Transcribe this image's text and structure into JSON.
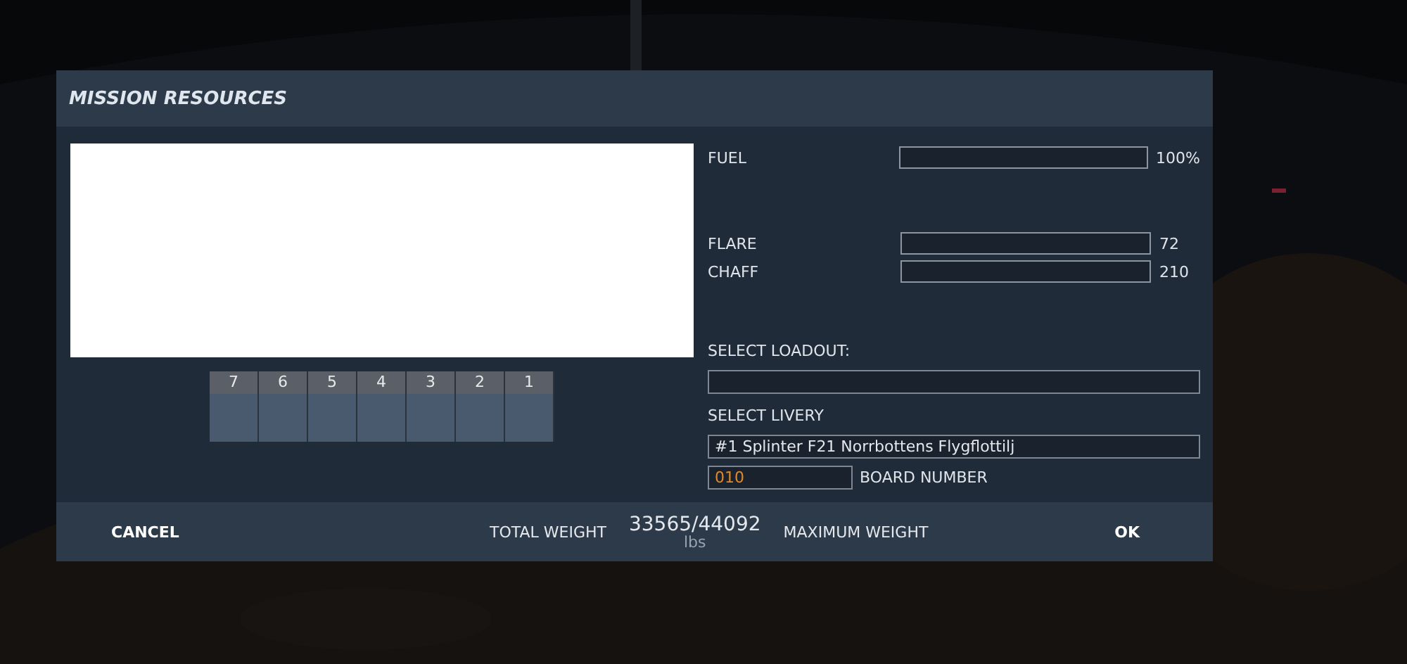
{
  "dialog": {
    "title": "MISSION RESOURCES"
  },
  "pylons": [
    {
      "label": "7"
    },
    {
      "label": "6"
    },
    {
      "label": "5"
    },
    {
      "label": "4"
    },
    {
      "label": "3"
    },
    {
      "label": "2"
    },
    {
      "label": "1"
    }
  ],
  "fuel": {
    "label": "FUEL",
    "reading": "100%"
  },
  "countermeasures": [
    {
      "label": "FLARE",
      "reading": "72"
    },
    {
      "label": "CHAFF",
      "reading": "210"
    }
  ],
  "loadout": {
    "label": "SELECT LOADOUT:"
  },
  "livery": {
    "label": "SELECT LIVERY",
    "value": "#1 Splinter F21 Norrbottens Flygflottilj"
  },
  "board_number": {
    "value": "010",
    "label": "BOARD NUMBER"
  },
  "footer": {
    "cancel": "CANCEL",
    "total_weight_label": "TOTAL WEIGHT",
    "weight": "33565/44092",
    "unit": "lbs",
    "maximum_weight_label": "MAXIMUM WEIGHT",
    "ok": "OK"
  }
}
